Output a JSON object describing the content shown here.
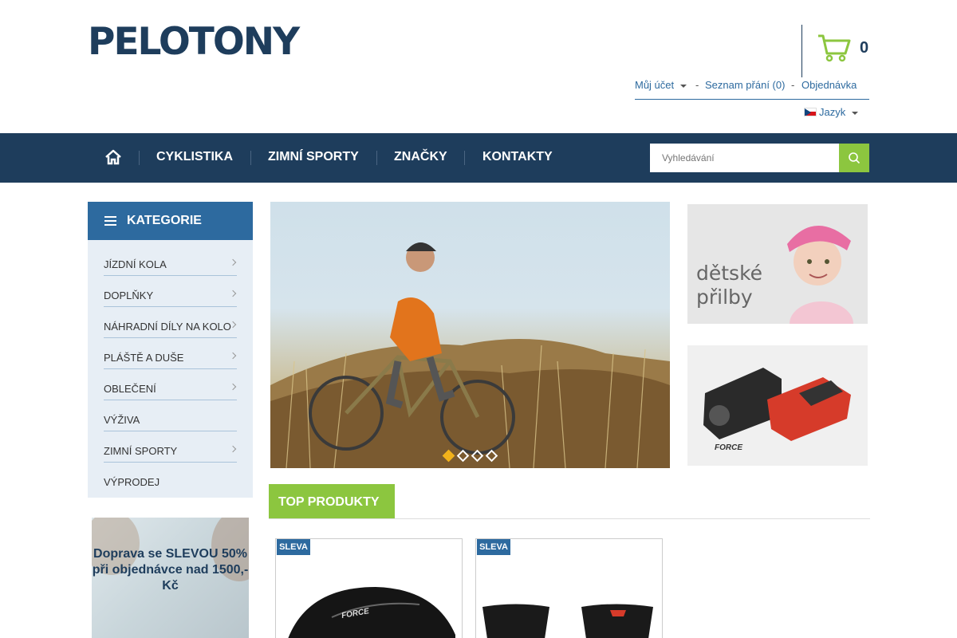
{
  "header": {
    "logo_text": "PELOTONY",
    "cart_count": "0",
    "account_label": "Můj účet",
    "wishlist_label": "Seznam přání (0)",
    "order_label": "Objednávka",
    "separator": "-",
    "language_label": "Jazyk"
  },
  "nav": {
    "items": [
      "CYKLISTIKA",
      "ZIMNÍ SPORTY",
      "ZNAČKY",
      "KONTAKTY"
    ],
    "search_placeholder": "Vyhledávání"
  },
  "sidebar": {
    "title": "KATEGORIE",
    "items": [
      {
        "label": "JÍZDNÍ KOLA",
        "has_children": true
      },
      {
        "label": "DOPLŇKY",
        "has_children": true
      },
      {
        "label": "NÁHRADNÍ DÍLY NA KOLO",
        "has_children": true
      },
      {
        "label": "PLÁŠTĚ A DUŠE",
        "has_children": true
      },
      {
        "label": "OBLEČENÍ",
        "has_children": true
      },
      {
        "label": "VÝŽIVA",
        "has_children": false
      },
      {
        "label": "ZIMNÍ SPORTY",
        "has_children": true
      },
      {
        "label": "VÝPRODEJ",
        "has_children": false
      }
    ],
    "promo_text": "Doprava se SLEVOU 50% při objednávce nad 1500,- Kč"
  },
  "slider": {
    "slide_count": 4,
    "active_slide": 1
  },
  "banners": {
    "kids_helmet_text": "dětské přilby",
    "force_logo_text": "FORCE"
  },
  "top_products": {
    "title": "TOP PRODUKTY",
    "products": [
      {
        "badge": "SLEVA",
        "brand_text": "FORCE"
      },
      {
        "badge": "SLEVA"
      }
    ]
  },
  "colors": {
    "navy": "#1e3d5c",
    "blue": "#2d6a9f",
    "green": "#8cc63f",
    "accent_yellow": "#f2b21b"
  }
}
